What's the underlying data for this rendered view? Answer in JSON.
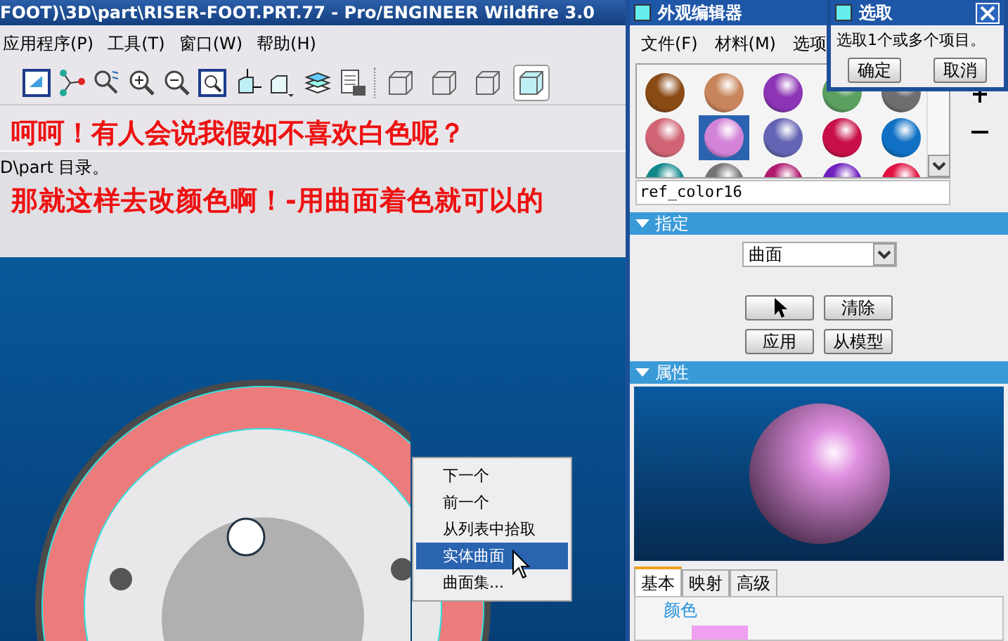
{
  "main_window": {
    "title": "FOOT)\\3D\\part\\RISER-FOOT.PRT.77 - Pro/ENGINEER Wildfire 3.0",
    "menu": [
      "应用程序(P)",
      "工具(T)",
      "窗口(W)",
      "帮助(H)"
    ],
    "display_buttons": [
      {
        "selected": false
      },
      {
        "selected": false
      },
      {
        "selected": false
      },
      {
        "selected": true
      }
    ],
    "annotations": [
      "呵呵！有人会说我假如不喜欢白色呢？",
      "那就这样去改颜色啊！-用曲面着色就可以的"
    ],
    "message": "D\\part 目录。",
    "context_menu": [
      {
        "label": "下一个",
        "selected": false
      },
      {
        "label": "前一个",
        "selected": false
      },
      {
        "label": "从列表中拾取",
        "selected": false
      },
      {
        "label": "实体曲面",
        "selected": true
      },
      {
        "label": "曲面集...",
        "selected": false
      }
    ]
  },
  "appearance_editor": {
    "title": "外观编辑器",
    "menu": [
      "文件(F)",
      "材料(M)",
      "选项"
    ],
    "palette": [
      {
        "color": "#8a4a14",
        "selected": false
      },
      {
        "color": "#c8845a",
        "selected": false
      },
      {
        "color": "#8c34b4",
        "selected": false
      },
      {
        "color": "#5ca060",
        "selected": false
      },
      {
        "color": "#6e6e6e",
        "selected": false
      },
      {
        "color": "#d06474",
        "selected": false
      },
      {
        "color": "#d484d8",
        "selected": true
      },
      {
        "color": "#6464b4",
        "selected": false
      },
      {
        "color": "#c81048",
        "selected": false
      },
      {
        "color": "#1070c4",
        "selected": false
      },
      {
        "color": "#10888c",
        "selected": false
      },
      {
        "color": "#747474",
        "selected": false
      },
      {
        "color": "#b01c70",
        "selected": false
      },
      {
        "color": "#7020c0",
        "selected": false
      },
      {
        "color": "#e01040",
        "selected": false
      }
    ],
    "name_field": "ref_color16",
    "assign_section": {
      "title": "指定",
      "expanded": true,
      "dropdown": "曲面",
      "buttons": [
        "清除",
        "应用",
        "从模型"
      ]
    },
    "properties_section": {
      "title": "属性",
      "expanded": true
    },
    "tabs": [
      {
        "label": "基本",
        "selected": true
      },
      {
        "label": "映射",
        "selected": false
      },
      {
        "label": "高级",
        "selected": false
      }
    ],
    "group_label": "颜色",
    "swatch": {
      "color": "#f0a0f0"
    }
  },
  "select_dialog": {
    "title": "选取",
    "prompt": "选取1个或多个项目。",
    "buttons": [
      "确定",
      "取消"
    ]
  }
}
